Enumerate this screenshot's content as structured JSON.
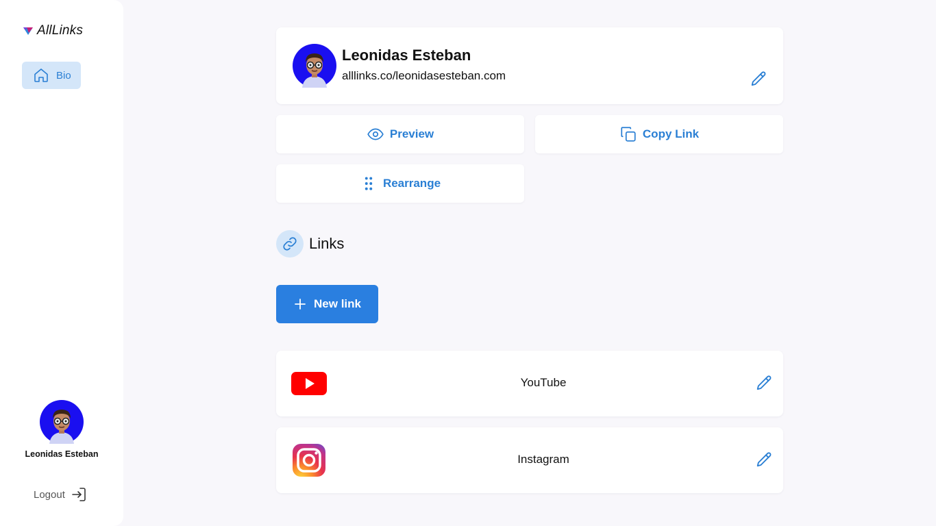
{
  "app": {
    "name": "AllLinks"
  },
  "sidebar": {
    "nav": [
      {
        "label": "Bio",
        "icon": "home-icon",
        "active": true
      }
    ],
    "user": {
      "name": "Leonidas Esteban"
    },
    "logout_label": "Logout"
  },
  "profile": {
    "name": "Leonidas Esteban",
    "url": "alllinks.co/leonidasesteban.com"
  },
  "actions": {
    "preview": "Preview",
    "copy_link": "Copy Link",
    "rearrange": "Rearrange"
  },
  "links_section": {
    "title": "Links",
    "new_link_label": "New link",
    "items": [
      {
        "label": "YouTube",
        "icon": "youtube-icon"
      },
      {
        "label": "Instagram",
        "icon": "instagram-icon"
      }
    ]
  },
  "colors": {
    "accent": "#2a7fd4",
    "accent_bg": "#d4e6f9",
    "primary_button": "#2a7fe0",
    "page_bg": "#f8f7fb",
    "avatar_bg": "#1a0ff0"
  }
}
